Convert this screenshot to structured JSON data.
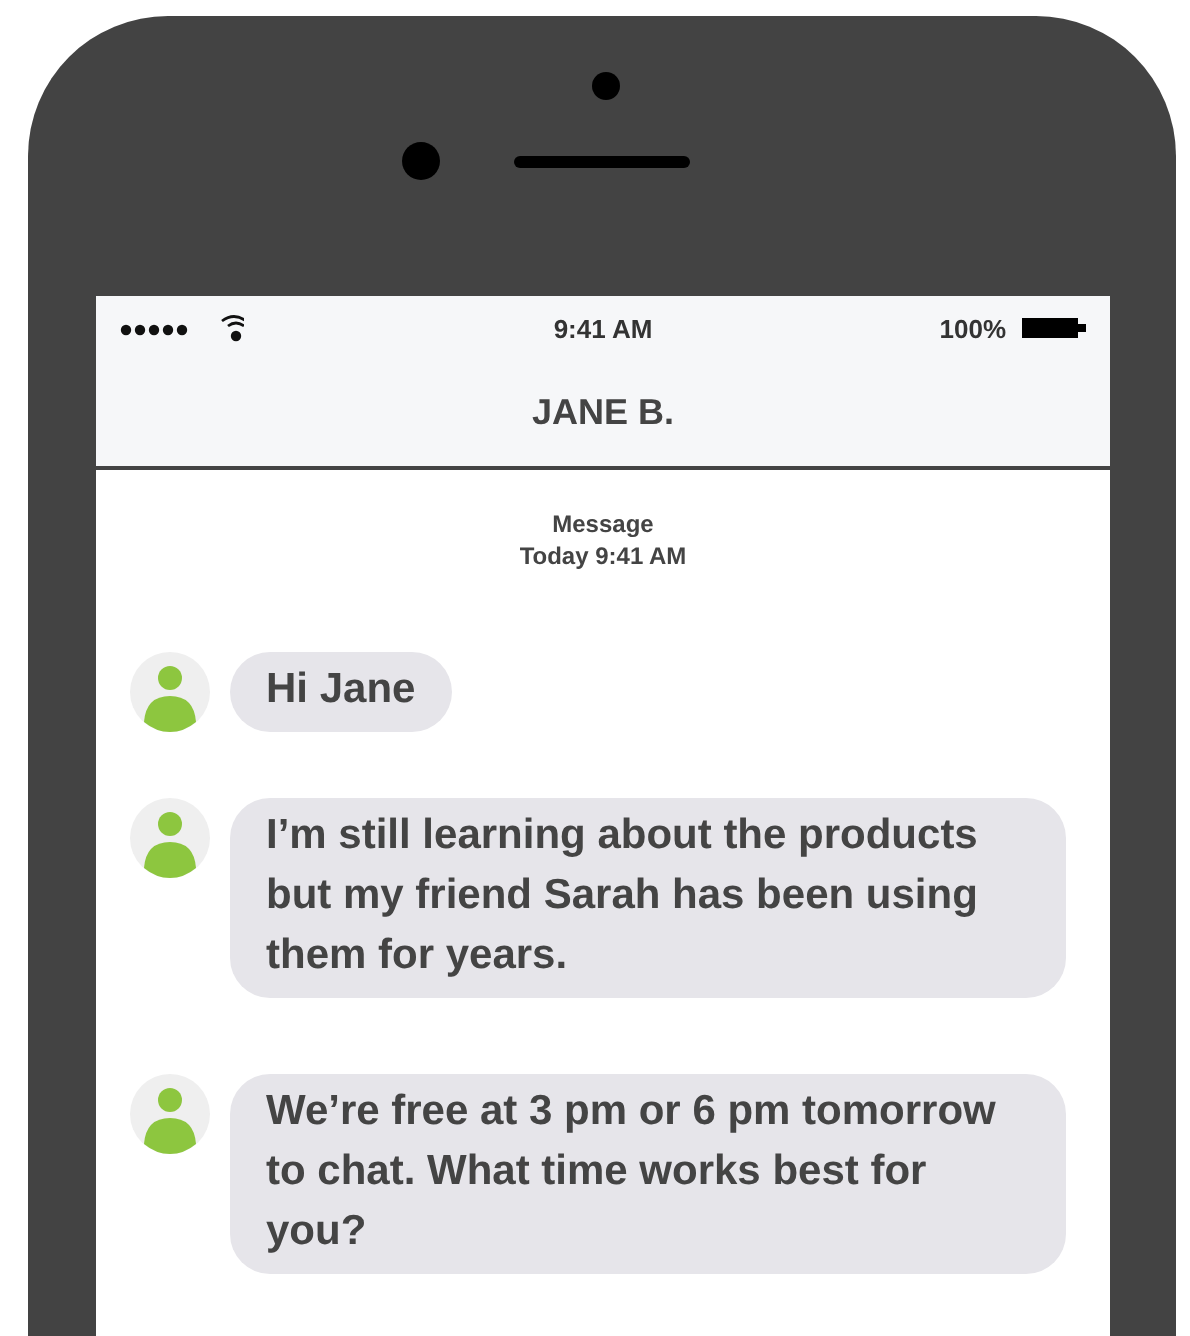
{
  "status_bar": {
    "time": "9:41 AM",
    "battery": "100%"
  },
  "header": {
    "title": "JANE B."
  },
  "thread_info": {
    "label": "Message",
    "timestamp": "Today 9:41 AM"
  },
  "messages": [
    {
      "text": "Hi Jane"
    },
    {
      "text": "I’m still learning about the products but my friend Sarah has been using them for years."
    },
    {
      "text": "We’re free at 3 pm or 6 pm tomorrow to chat. What time works best for you?"
    }
  ]
}
